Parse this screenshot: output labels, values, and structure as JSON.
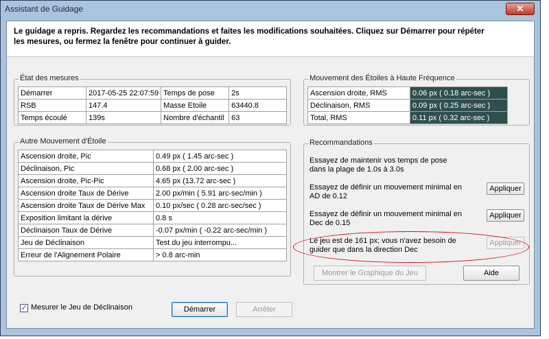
{
  "window": {
    "title": "Assistant de Guidage",
    "close_icon": "✕"
  },
  "banner": {
    "line1": "Le guidage a repris. Regardez les recommandations et faites les modifications souhaitées. Cliquez sur Démarrer pour répéter",
    "line2": "les mesures, ou fermez la fenêtre pour continuer à guider."
  },
  "etat": {
    "title": "État des mesures",
    "rows": [
      [
        "Démarrer",
        "2017-05-25 22:07:59",
        "Temps de pose",
        "2s"
      ],
      [
        "RSB",
        "147.4",
        "Masse Etoile",
        "63440.8"
      ],
      [
        "Temps écoulé",
        "139s",
        "Nombre d'échantil",
        "63"
      ]
    ]
  },
  "hf": {
    "title": "Mouvement des Étoiles à Haute Fréquence",
    "rows": [
      [
        "Ascension droite, RMS",
        "0.06 px ( 0.18 arc-sec )"
      ],
      [
        "Déclinaison, RMS",
        "0.09 px ( 0.25 arc-sec )"
      ],
      [
        "Total, RMS",
        "0.11 px ( 0.32 arc-sec )"
      ]
    ]
  },
  "autre": {
    "title": "Autre Mouvement d'Étoile",
    "rows": [
      [
        "Ascension droite, Pic",
        "0.49 px ( 1.45 arc-sec )"
      ],
      [
        "Déclinaison, Pic",
        "0.68 px ( 2.00 arc-sec )"
      ],
      [
        "Ascension droite, Pic-Pic",
        "4.65 px (13.72 arc-sec )"
      ],
      [
        "Ascension droite Taux de Dérive",
        "2.00 px/min ( 5.91 arc-sec/min )"
      ],
      [
        "Ascension droite Taux de Dérive Max",
        "0.10 px/sec ( 0.28 arc-sec/sec )"
      ],
      [
        "Exposition limitant la dérive",
        "0.8 s"
      ],
      [
        "Déclinaison Taux de Dérive",
        "-0.07 px/min ( -0.22 arc-sec/min )"
      ],
      [
        "Jeu de Déclinaison",
        "Test du jeu interrompu..."
      ],
      [
        "Erreur de l'Alignement Polaire",
        "> 0.8 arc-min"
      ]
    ]
  },
  "recommandations": {
    "title": "Recommandations",
    "items": [
      {
        "text": "Essayez de maintenir vos temps de pose dans la plage de 1.0s à 3.0s",
        "button": ""
      },
      {
        "text": "Essayez de définir un mouvement minimal en AD de 0.12",
        "button": "Appliquer"
      },
      {
        "text": "Essayez de définir un mouvement minimal en Dec de 0.15",
        "button": "Appliquer"
      },
      {
        "text": "Le jeu est de 161 px; vous n'avez besoin de guider que dans la direction Dec",
        "button": "Appliquer"
      }
    ],
    "show_graph": "Montrer le Graphique du Jeu",
    "help": "Aide"
  },
  "footer": {
    "checkbox_label": "Mesurer le Jeu de Déclinaison",
    "checkbox_mark": "✓",
    "start": "Démarrer",
    "stop": "Arrêter"
  }
}
